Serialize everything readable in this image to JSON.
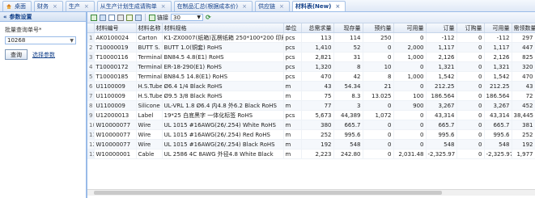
{
  "tabs": [
    {
      "label": "桌面",
      "active": false
    },
    {
      "label": "财务",
      "active": false
    },
    {
      "label": "生产",
      "active": false
    },
    {
      "label": "从生产计划生成请购单",
      "active": false
    },
    {
      "label": "在制品汇总(根据成本价)",
      "active": false
    },
    {
      "label": "供应链",
      "active": false
    },
    {
      "label": "材料表(New)",
      "active": true
    }
  ],
  "left_panel": {
    "title": "参数设置",
    "field_label": "批量查询单号*",
    "select_value": "10268",
    "query_button": "查询",
    "more_link": "选择参数"
  },
  "toolbar": {
    "link_label": "链接",
    "page_size": "30"
  },
  "columns": [
    "",
    "材料编号",
    "材料名称",
    "材料规格",
    "单位",
    "总需求量",
    "现存量",
    "预约量",
    "可用量",
    "订量",
    "订购量",
    "可用量",
    "需领数量"
  ],
  "rows": [
    [
      "1",
      "AK0100024",
      "Carton",
      "K1-ZX0007(纸箱)瓦楞纸箱 250*100*200 印刷纸箱",
      "pcs",
      "113",
      "114",
      "250",
      "0",
      "-112",
      "0",
      "-112",
      "297"
    ],
    [
      "2",
      "T10000019",
      "BUTT S.",
      "BUTT 1.0(铜套) RoHS",
      "pcs",
      "1,410",
      "52",
      "0",
      "2,000",
      "1,117",
      "0",
      "1,117",
      "447"
    ],
    [
      "3",
      "T10000116",
      "Terminal",
      "BN84.5 4.8(E1) RoHS",
      "pcs",
      "2,821",
      "31",
      "0",
      "1,000",
      "2,126",
      "0",
      "2,126",
      "825"
    ],
    [
      "4",
      "T10000172",
      "Terminal",
      "ER-18-290(E1) RoHS",
      "pcs",
      "1,320",
      "8",
      "10",
      "0",
      "1,321",
      "0",
      "1,321",
      "320"
    ],
    [
      "5",
      "T10000185",
      "Terminal",
      "BN84.5 14.8(E1) RoHS",
      "pcs",
      "470",
      "42",
      "8",
      "1,000",
      "1,542",
      "0",
      "1,542",
      "470"
    ],
    [
      "6",
      "U1100009",
      "H.S.Tube",
      "Ø6.4 1/4 Black RoHS",
      "m",
      "43",
      "54.34",
      "21",
      "0",
      "212.25",
      "0",
      "212.25",
      "43"
    ],
    [
      "7",
      "U1100009",
      "H.S.Tube",
      "Ø9.5 3/8 Black RoHS",
      "m",
      "75",
      "8.3",
      "13.025",
      "100",
      "186.564",
      "0",
      "186.564",
      "72"
    ],
    [
      "8",
      "U1100009",
      "Silicone",
      "UL-VRL 1.8 Ø6.4 内4.8 外6.2 Black RoHS",
      "m",
      "77",
      "3",
      "0",
      "900",
      "3,267",
      "0",
      "3,267",
      "452"
    ],
    [
      "9",
      "U12000013",
      "Label",
      "19*25 白底黑字 一体化标签 RoHS",
      "pcs",
      "5,673",
      "44,389",
      "1,072",
      "0",
      "43,314",
      "0",
      "43,314",
      "38,445"
    ],
    [
      "10",
      "W10000077",
      "Wire",
      "UL 1015 #16AWG(26/.254) White RoHS",
      "m",
      "380",
      "665.7",
      "0",
      "0",
      "665.7",
      "0",
      "665.7",
      "381"
    ],
    [
      "11",
      "W10000077",
      "Wire",
      "UL 1015 #16AWG(26/.254) Red RoHS",
      "m",
      "252",
      "995.6",
      "0",
      "0",
      "995.6",
      "0",
      "995.6",
      "252"
    ],
    [
      "12",
      "W10000077",
      "Wire",
      "UL 1015 #16AWG(26/.254) Black RoHS",
      "m",
      "192",
      "548",
      "0",
      "0",
      "548",
      "0",
      "548",
      "192"
    ],
    [
      "13",
      "W10000001",
      "Cable",
      "UL 2586 4C 8AWG 外径4.8 White Black",
      "m",
      "2,223",
      "242.80",
      "0",
      "2,031.48",
      "-2,325.97",
      "0",
      "-2,325.97",
      "1,977"
    ]
  ],
  "colors": {
    "accent": "#15428b",
    "border": "#99bbe8",
    "header_bg": "#e2eaf6"
  }
}
